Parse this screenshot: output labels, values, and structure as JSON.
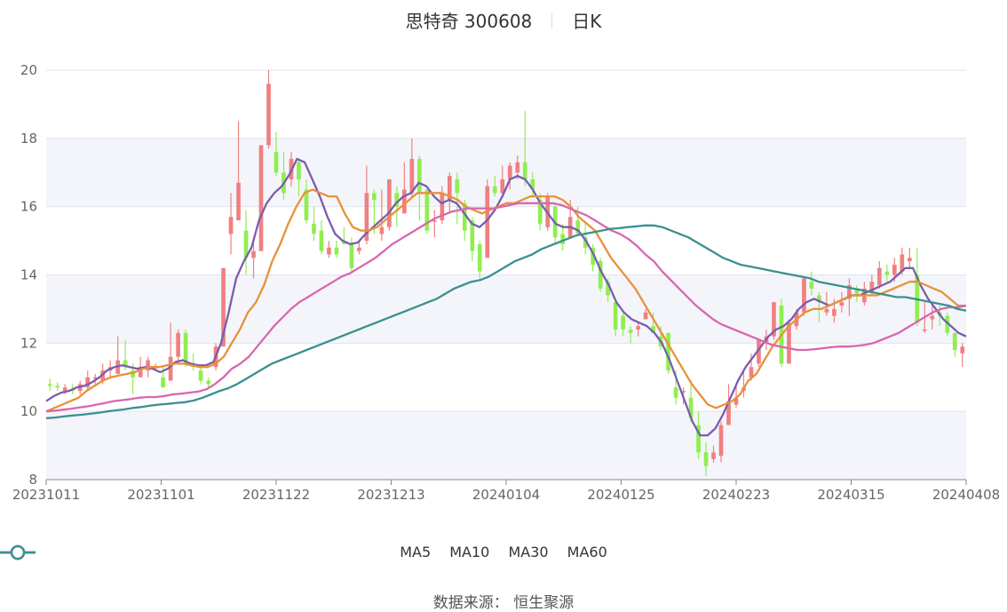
{
  "title": {
    "name": "思特奇 300608",
    "period": "日K"
  },
  "source": "数据来源： 恒生聚源",
  "colors": {
    "up": "#f08080",
    "down": "#90ee50",
    "MA5": "#7a5cb0",
    "MA10": "#e8913a",
    "MA30": "#d966b0",
    "MA60": "#3a9090"
  },
  "chart_data": {
    "type": "candlestick",
    "xticks": [
      "20231011",
      "20231101",
      "20231122",
      "20231213",
      "20240104",
      "20240125",
      "20240223",
      "20240315",
      "20240408"
    ],
    "yticks": [
      8,
      10,
      12,
      14,
      16,
      18,
      20
    ],
    "ylim": [
      8,
      20
    ],
    "legend": [
      "MA5",
      "MA10",
      "MA30",
      "MA60"
    ],
    "candles": [
      [
        10.8,
        10.75,
        10.95,
        10.6
      ],
      [
        10.75,
        10.7,
        10.85,
        10.6
      ],
      [
        10.6,
        10.7,
        10.8,
        10.5
      ],
      [
        10.65,
        10.6,
        10.8,
        10.5
      ],
      [
        10.6,
        10.8,
        10.9,
        10.5
      ],
      [
        10.7,
        11.0,
        11.2,
        10.6
      ],
      [
        11.0,
        11.0,
        11.1,
        10.8
      ],
      [
        10.9,
        11.2,
        11.4,
        10.8
      ],
      [
        11.2,
        11.3,
        11.5,
        11.0
      ],
      [
        11.1,
        11.5,
        12.2,
        11.1
      ],
      [
        11.5,
        11.3,
        12.1,
        11.2
      ],
      [
        11.2,
        11.0,
        11.4,
        10.5
      ],
      [
        11.0,
        11.3,
        11.6,
        11.0
      ],
      [
        11.2,
        11.5,
        11.6,
        11.0
      ],
      [
        11.3,
        11.3,
        11.4,
        11.2
      ],
      [
        11.0,
        10.7,
        11.3,
        10.7
      ],
      [
        10.9,
        11.6,
        12.6,
        10.9
      ],
      [
        11.6,
        12.3,
        12.4,
        11.4
      ],
      [
        12.3,
        11.4,
        12.4,
        11.3
      ],
      [
        11.4,
        11.3,
        11.7,
        11.2
      ],
      [
        11.2,
        10.9,
        11.3,
        10.8
      ],
      [
        10.9,
        10.8,
        11.0,
        10.7
      ],
      [
        11.3,
        11.9,
        12.0,
        11.2
      ],
      [
        11.9,
        14.2,
        14.2,
        11.9
      ],
      [
        15.2,
        15.7,
        16.4,
        14.6
      ],
      [
        15.6,
        16.7,
        18.5,
        15.6
      ],
      [
        15.3,
        14.5,
        15.9,
        14.0
      ],
      [
        14.5,
        14.7,
        15.1,
        13.9
      ],
      [
        14.7,
        17.8,
        17.8,
        14.7
      ],
      [
        17.8,
        19.6,
        20.0,
        17.7
      ],
      [
        17.6,
        17.0,
        18.2,
        16.9
      ],
      [
        17.0,
        16.4,
        17.6,
        16.2
      ],
      [
        16.8,
        17.4,
        17.6,
        16.6
      ],
      [
        17.3,
        16.8,
        17.4,
        16.3
      ],
      [
        16.5,
        15.6,
        16.8,
        15.5
      ],
      [
        15.5,
        15.2,
        16.0,
        15.0
      ],
      [
        15.3,
        14.7,
        15.6,
        14.6
      ],
      [
        14.6,
        14.8,
        15.0,
        14.5
      ],
      [
        14.8,
        14.6,
        15.0,
        14.5
      ],
      [
        15.0,
        14.9,
        15.4,
        14.9
      ],
      [
        14.9,
        14.2,
        15.1,
        14.1
      ],
      [
        14.7,
        14.8,
        15.0,
        14.6
      ],
      [
        15.0,
        16.4,
        17.2,
        14.9
      ],
      [
        16.4,
        16.2,
        16.5,
        15.2
      ],
      [
        15.2,
        15.4,
        16.5,
        15.0
      ],
      [
        15.4,
        16.8,
        16.8,
        15.3
      ],
      [
        16.4,
        16.0,
        16.6,
        15.4
      ],
      [
        15.8,
        16.5,
        17.3,
        15.8
      ],
      [
        16.4,
        17.4,
        18.0,
        16.3
      ],
      [
        17.4,
        16.4,
        17.5,
        15.6
      ],
      [
        16.5,
        15.3,
        16.5,
        15.2
      ],
      [
        15.6,
        15.6,
        15.9,
        15.1
      ],
      [
        15.6,
        16.4,
        16.6,
        15.5
      ],
      [
        16.2,
        16.9,
        17.0,
        15.8
      ],
      [
        16.8,
        16.4,
        17.0,
        15.5
      ],
      [
        16.1,
        15.3,
        16.2,
        15.0
      ],
      [
        15.6,
        14.7,
        15.7,
        14.4
      ],
      [
        14.9,
        14.1,
        15.0,
        13.9
      ],
      [
        14.5,
        16.6,
        16.8,
        14.5
      ],
      [
        16.6,
        16.4,
        16.9,
        16.3
      ],
      [
        16.4,
        16.8,
        17.2,
        16.3
      ],
      [
        16.8,
        17.2,
        17.3,
        16.5
      ],
      [
        17.0,
        17.3,
        17.5,
        16.8
      ],
      [
        17.3,
        16.8,
        18.8,
        16.6
      ],
      [
        16.8,
        16.5,
        17.0,
        16.3
      ],
      [
        16.2,
        15.5,
        16.4,
        15.3
      ],
      [
        15.4,
        16.3,
        16.4,
        15.3
      ],
      [
        16.0,
        15.1,
        16.1,
        14.9
      ],
      [
        15.2,
        14.9,
        15.5,
        14.7
      ],
      [
        15.1,
        15.7,
        16.2,
        15.1
      ],
      [
        15.6,
        15.2,
        16.0,
        15.2
      ],
      [
        15.1,
        14.8,
        15.5,
        14.6
      ],
      [
        14.8,
        14.3,
        14.9,
        14.1
      ],
      [
        14.4,
        13.6,
        14.5,
        13.5
      ],
      [
        13.8,
        13.4,
        13.9,
        13.2
      ],
      [
        13.2,
        12.4,
        13.2,
        12.2
      ],
      [
        12.8,
        12.4,
        12.9,
        12.2
      ],
      [
        12.4,
        12.3,
        12.5,
        12.0
      ],
      [
        12.4,
        12.5,
        12.6,
        12.2
      ],
      [
        12.7,
        12.9,
        13.0,
        12.7
      ],
      [
        12.5,
        12.3,
        12.9,
        12.3
      ],
      [
        12.2,
        11.9,
        12.5,
        11.8
      ],
      [
        12.3,
        11.2,
        12.3,
        11.1
      ],
      [
        10.7,
        10.4,
        11.2,
        10.2
      ],
      [
        10.6,
        10.6,
        10.7,
        10.2
      ],
      [
        10.4,
        9.8,
        10.9,
        9.7
      ],
      [
        9.6,
        8.8,
        10.0,
        8.6
      ],
      [
        8.8,
        8.4,
        9.1,
        8.1
      ],
      [
        8.6,
        8.8,
        9.0,
        8.5
      ],
      [
        8.7,
        9.6,
        9.7,
        8.5
      ],
      [
        9.6,
        10.3,
        10.8,
        9.6
      ],
      [
        10.2,
        10.4,
        10.8,
        10.1
      ],
      [
        10.6,
        10.7,
        11.2,
        10.4
      ],
      [
        11.0,
        11.3,
        11.7,
        10.9
      ],
      [
        11.4,
        12.1,
        12.1,
        11.3
      ],
      [
        12.0,
        12.2,
        12.4,
        11.8
      ],
      [
        12.2,
        13.2,
        13.2,
        12.1
      ],
      [
        13.1,
        11.4,
        13.3,
        11.3
      ],
      [
        11.4,
        12.6,
        12.7,
        11.4
      ],
      [
        12.5,
        12.9,
        13.0,
        12.4
      ],
      [
        12.9,
        13.9,
        13.9,
        12.8
      ],
      [
        13.8,
        13.6,
        14.1,
        13.4
      ],
      [
        13.4,
        13.2,
        13.5,
        12.6
      ],
      [
        12.9,
        13.0,
        13.5,
        12.8
      ],
      [
        12.8,
        13.0,
        13.3,
        12.6
      ],
      [
        13.1,
        13.2,
        13.5,
        12.9
      ],
      [
        13.3,
        13.7,
        13.9,
        12.8
      ],
      [
        13.6,
        13.4,
        13.7,
        13.2
      ],
      [
        13.2,
        13.6,
        13.8,
        13.1
      ],
      [
        13.5,
        13.8,
        14.0,
        13.4
      ],
      [
        13.7,
        14.2,
        14.4,
        13.6
      ],
      [
        14.1,
        14.0,
        14.3,
        13.8
      ],
      [
        14.0,
        14.3,
        14.5,
        13.8
      ],
      [
        14.1,
        14.6,
        14.8,
        14.0
      ],
      [
        14.4,
        14.5,
        14.8,
        14.2
      ],
      [
        14.0,
        12.6,
        14.8,
        12.5
      ],
      [
        12.4,
        12.4,
        13.2,
        12.3
      ],
      [
        12.7,
        12.8,
        13.1,
        12.4
      ],
      [
        12.9,
        12.8,
        13.1,
        12.5
      ],
      [
        12.8,
        12.3,
        12.9,
        12.2
      ],
      [
        12.3,
        11.8,
        12.3,
        11.6
      ],
      [
        11.7,
        11.9,
        12.0,
        11.3
      ]
    ],
    "series": [
      {
        "name": "MA5",
        "values": [
          10.3,
          10.45,
          10.55,
          10.6,
          10.7,
          10.75,
          10.85,
          11.0,
          11.2,
          11.3,
          11.35,
          11.3,
          11.25,
          11.3,
          11.25,
          11.15,
          11.25,
          11.45,
          11.5,
          11.4,
          11.35,
          11.35,
          11.45,
          12.0,
          12.9,
          13.9,
          14.4,
          14.8,
          15.6,
          16.1,
          16.4,
          16.6,
          16.95,
          17.4,
          17.3,
          16.8,
          16.3,
          15.7,
          15.2,
          15.0,
          14.9,
          14.95,
          15.2,
          15.4,
          15.6,
          15.8,
          16.1,
          16.3,
          16.4,
          16.7,
          16.6,
          16.3,
          16.1,
          16.2,
          16.1,
          15.8,
          15.5,
          15.4,
          15.6,
          15.9,
          16.3,
          16.8,
          16.9,
          16.8,
          16.5,
          16.1,
          15.8,
          15.5,
          15.4,
          15.4,
          15.3,
          15.0,
          14.6,
          14.1,
          13.7,
          13.2,
          12.9,
          12.7,
          12.6,
          12.5,
          12.3,
          12.0,
          11.5,
          10.9,
          10.3,
          9.7,
          9.3,
          9.3,
          9.5,
          9.9,
          10.4,
          10.9,
          11.3,
          11.6,
          11.9,
          12.2,
          12.4,
          12.5,
          12.7,
          13.0,
          13.2,
          13.3,
          13.2,
          13.1,
          13.2,
          13.3,
          13.4,
          13.4,
          13.5,
          13.6,
          13.7,
          13.8,
          14.0,
          14.2,
          14.2,
          13.7,
          13.3,
          13.0,
          12.7,
          12.5,
          12.3,
          12.2
        ]
      },
      {
        "name": "MA10",
        "values": [
          10.0,
          10.1,
          10.2,
          10.3,
          10.4,
          10.6,
          10.75,
          10.9,
          11.0,
          11.05,
          11.1,
          11.15,
          11.25,
          11.3,
          11.3,
          11.35,
          11.4,
          11.4,
          11.35,
          11.3,
          11.3,
          11.4,
          11.6,
          12.0,
          12.4,
          12.9,
          13.2,
          13.7,
          14.4,
          14.9,
          15.5,
          16.0,
          16.4,
          16.5,
          16.4,
          16.3,
          16.3,
          15.8,
          15.4,
          15.3,
          15.3,
          15.4,
          15.6,
          15.8,
          16.0,
          16.2,
          16.4,
          16.4,
          16.4,
          16.4,
          16.3,
          16.2,
          16.0,
          15.9,
          15.8,
          15.9,
          16.0,
          16.1,
          16.1,
          16.2,
          16.3,
          16.3,
          16.3,
          16.3,
          16.2,
          16.0,
          15.7,
          15.5,
          15.3,
          14.9,
          14.5,
          14.2,
          13.9,
          13.6,
          13.2,
          12.8,
          12.4,
          12.0,
          11.6,
          11.2,
          10.8,
          10.5,
          10.2,
          10.1,
          10.2,
          10.3,
          10.5,
          10.9,
          11.1,
          11.5,
          11.9,
          12.2,
          12.5,
          12.7,
          12.9,
          13.0,
          13.0,
          13.1,
          13.2,
          13.3,
          13.4,
          13.4,
          13.4,
          13.4,
          13.5,
          13.6,
          13.7,
          13.8,
          13.8,
          13.7,
          13.6,
          13.5,
          13.3,
          13.1,
          13.1
        ]
      },
      {
        "name": "MA30",
        "values": [
          10.0,
          10.02,
          10.05,
          10.08,
          10.12,
          10.15,
          10.2,
          10.25,
          10.3,
          10.33,
          10.36,
          10.4,
          10.42,
          10.42,
          10.45,
          10.5,
          10.52,
          10.55,
          10.58,
          10.65,
          10.8,
          11.0,
          11.25,
          11.4,
          11.6,
          11.9,
          12.2,
          12.5,
          12.75,
          13.0,
          13.2,
          13.35,
          13.5,
          13.65,
          13.8,
          13.95,
          14.05,
          14.2,
          14.35,
          14.5,
          14.7,
          14.9,
          15.05,
          15.2,
          15.35,
          15.5,
          15.65,
          15.75,
          15.85,
          15.9,
          15.95,
          15.95,
          15.95,
          15.95,
          16.0,
          16.05,
          16.1,
          16.1,
          16.1,
          16.1,
          16.1,
          16.05,
          15.95,
          15.85,
          15.75,
          15.6,
          15.45,
          15.3,
          15.2,
          15.05,
          14.85,
          14.6,
          14.4,
          14.1,
          13.85,
          13.6,
          13.35,
          13.1,
          12.9,
          12.7,
          12.55,
          12.45,
          12.35,
          12.25,
          12.15,
          12.05,
          11.95,
          11.9,
          11.85,
          11.8,
          11.8,
          11.82,
          11.85,
          11.88,
          11.9,
          11.9,
          11.92,
          11.95,
          12.0,
          12.1,
          12.2,
          12.3,
          12.45,
          12.6,
          12.75,
          12.9,
          13.0,
          13.05,
          13.05,
          13.1
        ]
      },
      {
        "name": "MA60",
        "values": [
          9.8,
          9.82,
          9.85,
          9.88,
          9.9,
          9.93,
          9.96,
          10.0,
          10.03,
          10.06,
          10.1,
          10.13,
          10.17,
          10.2,
          10.22,
          10.25,
          10.27,
          10.32,
          10.4,
          10.5,
          10.6,
          10.68,
          10.8,
          10.95,
          11.1,
          11.25,
          11.4,
          11.5,
          11.6,
          11.7,
          11.8,
          11.9,
          12.0,
          12.1,
          12.2,
          12.3,
          12.4,
          12.5,
          12.6,
          12.7,
          12.8,
          12.9,
          13.0,
          13.1,
          13.2,
          13.3,
          13.45,
          13.6,
          13.7,
          13.8,
          13.85,
          13.95,
          14.1,
          14.25,
          14.4,
          14.5,
          14.6,
          14.75,
          14.85,
          14.95,
          15.05,
          15.15,
          15.2,
          15.25,
          15.3,
          15.35,
          15.37,
          15.4,
          15.42,
          15.45,
          15.45,
          15.4,
          15.3,
          15.2,
          15.1,
          14.95,
          14.8,
          14.65,
          14.5,
          14.4,
          14.3,
          14.25,
          14.2,
          14.15,
          14.1,
          14.05,
          14.0,
          13.95,
          13.9,
          13.8,
          13.75,
          13.7,
          13.65,
          13.6,
          13.55,
          13.5,
          13.45,
          13.4,
          13.35,
          13.35,
          13.3,
          13.25,
          13.2,
          13.15,
          13.1,
          13.0,
          12.95
        ]
      }
    ]
  }
}
